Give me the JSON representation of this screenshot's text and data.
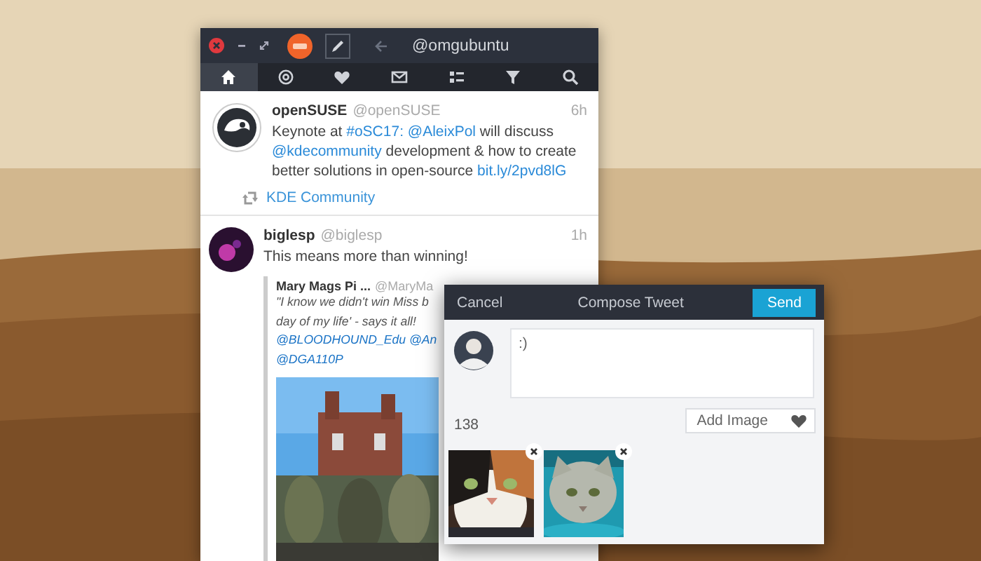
{
  "window": {
    "account": "@omgubuntu"
  },
  "tabs": [
    {
      "kind": "home",
      "selected": true
    },
    {
      "kind": "mentions",
      "selected": false
    },
    {
      "kind": "likes",
      "selected": false
    },
    {
      "kind": "messages",
      "selected": false
    },
    {
      "kind": "lists",
      "selected": false
    },
    {
      "kind": "filters",
      "selected": false
    },
    {
      "kind": "search",
      "selected": false
    }
  ],
  "tweets": [
    {
      "kind": "org",
      "name": "openSUSE",
      "handle": "@openSUSE",
      "time": "6h",
      "text": [
        {
          "kind": "plain",
          "text": "Keynote at "
        },
        {
          "kind": "link",
          "text": "#oSC17:"
        },
        {
          "kind": "link",
          "text": "@AleixPol"
        },
        {
          "kind": "plain",
          "text": " will discuss "
        },
        {
          "kind": "link",
          "text": "@kdecommunity"
        },
        {
          "kind": "plain",
          "text": " development & how to create better solutions in open-source "
        },
        {
          "kind": "link",
          "text": "bit.ly/2pvd8lG"
        }
      ],
      "retweeted_by": "KDE Community"
    },
    {
      "kind": "person",
      "name": "biglesp",
      "handle": "@biglesp",
      "time": "1h",
      "text": [
        {
          "kind": "plain",
          "text": "This means more than winning!"
        }
      ],
      "quote": {
        "name": "Mary Mags Pi ...",
        "handle": "@MaryMa",
        "lines": [
          [
            {
              "kind": "plain",
              "text": "\"I know we didn't win Miss b"
            }
          ],
          [
            {
              "kind": "plain",
              "text": "day of my life' - says it all!"
            }
          ],
          [
            {
              "kind": "link",
              "text": "@BLOODHOUND_Edu"
            },
            {
              "kind": "link",
              "text": "@An"
            }
          ],
          [
            {
              "kind": "link",
              "text": "@DGA110P"
            }
          ]
        ],
        "media": {
          "kind": "picture"
        }
      }
    }
  ],
  "compose": {
    "cancel": "Cancel",
    "title": "Compose Tweet",
    "send": "Send",
    "value": ":)",
    "count": "138",
    "add_image": "Add Image",
    "attachments": [
      {
        "kind": "picture"
      },
      {
        "kind": "picture"
      }
    ]
  }
}
